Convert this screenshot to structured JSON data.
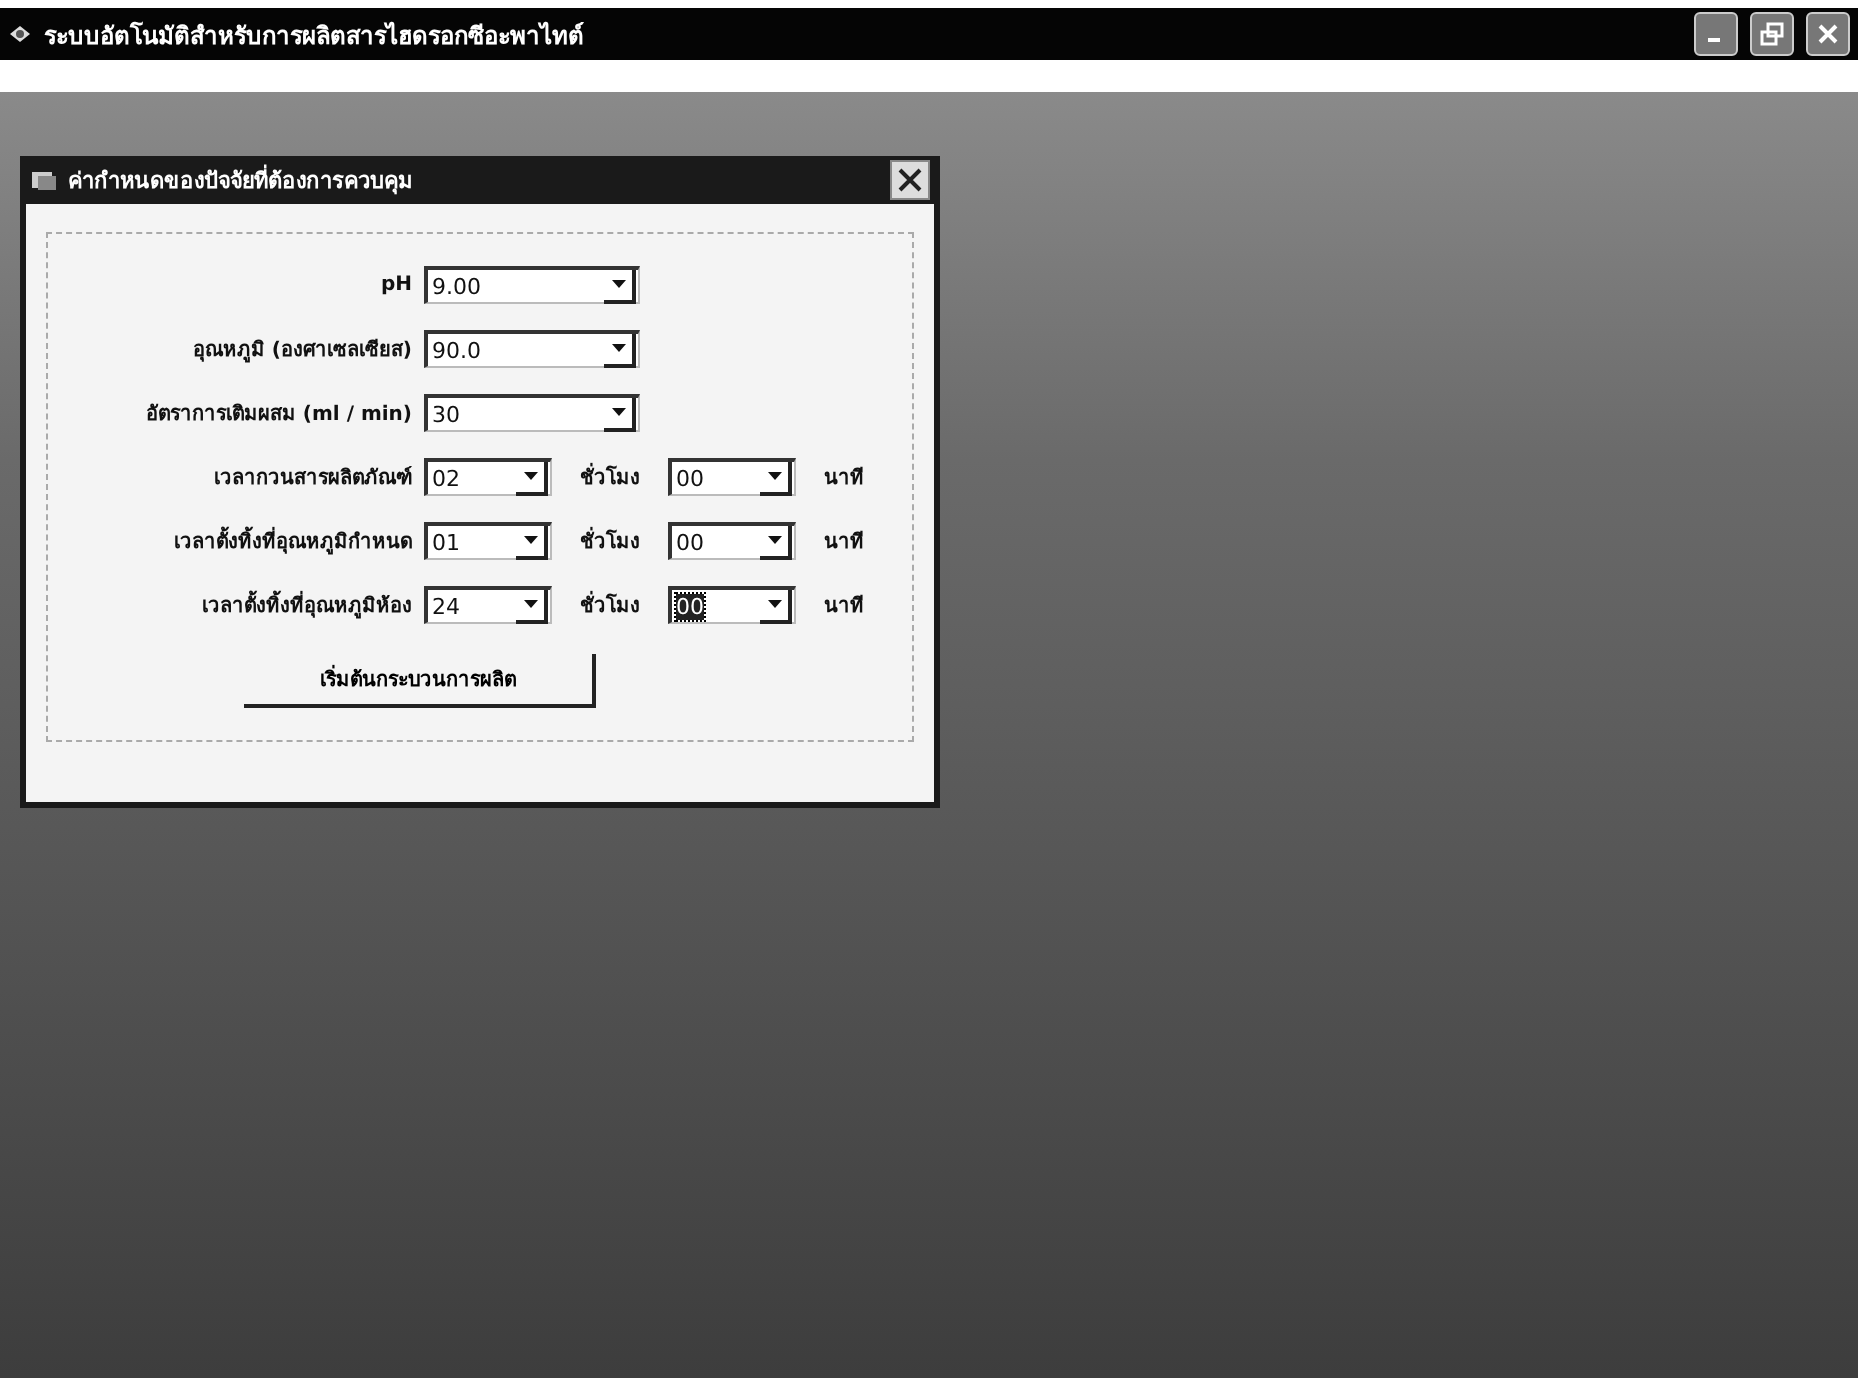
{
  "window": {
    "title": "ระบบอัตโนมัติสำหรับการผลิตสารไฮดรอกซีอะพาไทต์"
  },
  "dialog": {
    "title": "ค่ากำหนดของปัจจัยที่ต้องการควบคุม",
    "rows": [
      {
        "kind": "single",
        "label": "pH",
        "value": "9.00"
      },
      {
        "kind": "single",
        "label": "อุณหภูมิ (องศาเซลเซียส)",
        "value": "90.0"
      },
      {
        "kind": "single",
        "label": "อัตราการเติมผสม (ml / min)",
        "value": "30"
      },
      {
        "kind": "time",
        "label": "เวลากวนสารผลิตภัณฑ์",
        "hours": "02",
        "hours_unit": "ชั่วโมง",
        "minutes": "00",
        "minutes_unit": "นาที",
        "minutes_highlighted": false
      },
      {
        "kind": "time",
        "label": "เวลาตั้งทิ้งที่อุณหภูมิกำหนด",
        "hours": "01",
        "hours_unit": "ชั่วโมง",
        "minutes": "00",
        "minutes_unit": "นาที",
        "minutes_highlighted": false
      },
      {
        "kind": "time",
        "label": "เวลาตั้งทิ้งที่อุณหภูมิห้อง",
        "hours": "24",
        "hours_unit": "ชั่วโมง",
        "minutes": "00",
        "minutes_unit": "นาที",
        "minutes_highlighted": true
      }
    ],
    "button": "เริ่มต้นกระบวนการผลิต"
  }
}
